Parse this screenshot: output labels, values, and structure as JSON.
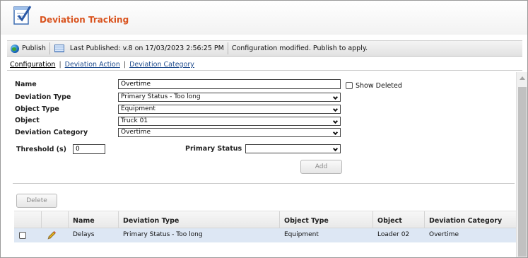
{
  "header": {
    "title": "Deviation Tracking",
    "app_icon": "checklist-icon"
  },
  "toolbar": {
    "publish_label": "Publish",
    "last_published": "Last Published: v.8 on 17/03/2023 2:56:25 PM",
    "status_message": "Configuration modified. Publish to apply."
  },
  "tabs": [
    {
      "label": "Configuration",
      "active": true
    },
    {
      "label": "Deviation Action",
      "active": false
    },
    {
      "label": "Deviation Category",
      "active": false
    }
  ],
  "tab_separator": "|",
  "form": {
    "name_label": "Name",
    "name_value": "Overtime",
    "show_deleted_label": "Show Deleted",
    "show_deleted_checked": false,
    "deviation_type_label": "Deviation Type",
    "deviation_type_value": "Primary Status - Too long",
    "object_type_label": "Object Type",
    "object_type_value": "Equipment",
    "object_label": "Object",
    "object_value": "Truck 01",
    "deviation_category_label": "Deviation Category",
    "deviation_category_value": "Overtime",
    "threshold_label": "Threshold (s)",
    "threshold_value": "0",
    "primary_status_label": "Primary Status",
    "primary_status_value": "",
    "add_label": "Add"
  },
  "grid": {
    "delete_label": "Delete",
    "columns": [
      "Name",
      "Deviation Type",
      "Object Type",
      "Object",
      "Deviation Category"
    ],
    "rows": [
      {
        "name": "Delays",
        "deviation_type": "Primary Status - Too long",
        "object_type": "Equipment",
        "object": "Loader 02",
        "deviation_category": "Overtime",
        "checked": false
      }
    ]
  },
  "colors": {
    "title": "#d9531e",
    "link": "#1d4a8c",
    "row_highlight": "#dde7f4"
  }
}
